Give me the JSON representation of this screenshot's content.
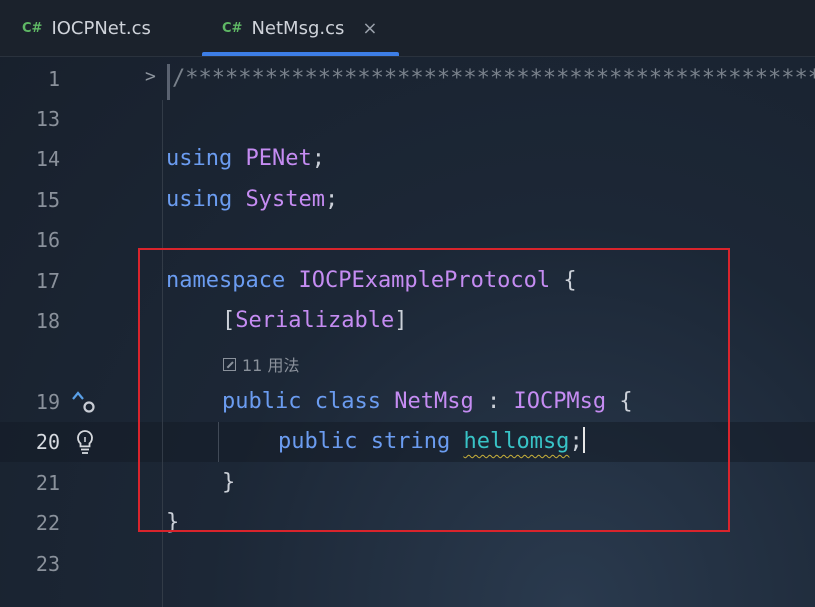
{
  "tabs": [
    {
      "lang": "C#",
      "label": "IOCPNet.cs",
      "active": false
    },
    {
      "lang": "C#",
      "label": "NetMsg.cs",
      "active": true,
      "close": "×"
    }
  ],
  "colors": {
    "keyword": "#6b9cf0",
    "type": "#c58cf2",
    "field": "#38c3c6",
    "highlight_box": "#d9242c",
    "tab_accent": "#3d7ee6",
    "cs_badge": "#5fb865"
  },
  "gutter": {
    "line_numbers": [
      "1",
      "13",
      "14",
      "15",
      "16",
      "17",
      "18",
      "19",
      "20",
      "21",
      "22",
      "23"
    ],
    "fold_glyph": ">",
    "icons": [
      "implementation-marker-icon",
      "lightbulb-icon"
    ]
  },
  "code": {
    "line1": "/*************************************************",
    "l14_kw": "using",
    "l14_ty": "PENet",
    "l14_end": ";",
    "l15_kw": "using",
    "l15_ty": "System",
    "l15_end": ";",
    "l17_kw": "namespace",
    "l17_ty": "IOCPExampleProtocol",
    "l17_end": " {",
    "l18_open": "[",
    "l18_ty": "Serializable",
    "l18_close": "]",
    "usages_text": "11 用法",
    "l19_kw1": "public",
    "l19_kw2": "class",
    "l19_ty": "NetMsg",
    "l19_colon": " : ",
    "l19_base": "IOCPMsg",
    "l19_end": " {",
    "l20_kw1": "public",
    "l20_kw2": "string",
    "l20_field": "hellomsg",
    "l20_end": ";",
    "l21": "}",
    "l22": "}"
  }
}
